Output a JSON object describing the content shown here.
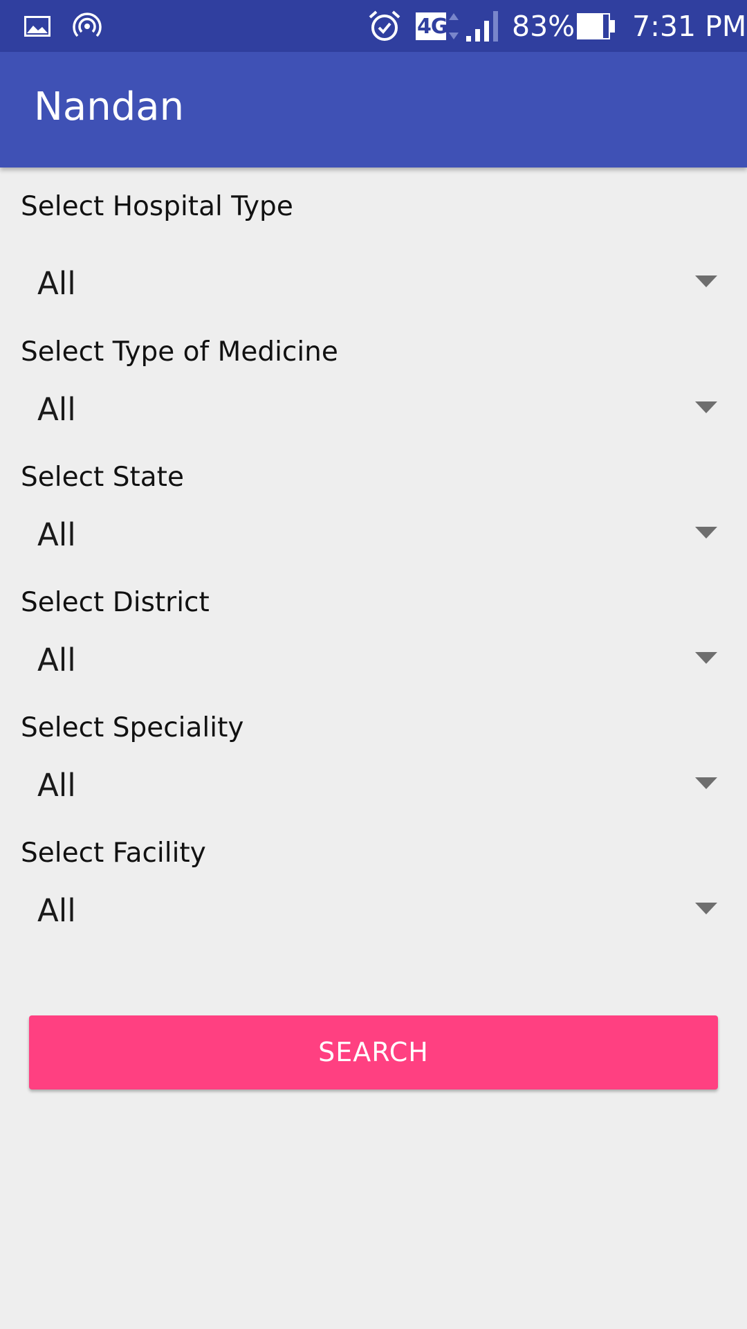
{
  "status_bar": {
    "icons_left": [
      "gallery-icon",
      "hotspot-icon"
    ],
    "icons_right": [
      "alarm-icon",
      "network-4g-icon",
      "signal-icon",
      "battery-icon"
    ],
    "network_label": "4G",
    "battery": "83%",
    "time": "7:31 PM"
  },
  "app_bar": {
    "title": "Nandan"
  },
  "form": {
    "fields": [
      {
        "label": "Select Hospital Type",
        "value": "All"
      },
      {
        "label": "Select Type of Medicine",
        "value": "All"
      },
      {
        "label": "Select State",
        "value": "All"
      },
      {
        "label": "Select District",
        "value": "All"
      },
      {
        "label": "Select Speciality",
        "value": "All"
      },
      {
        "label": "Select Facility",
        "value": "All"
      }
    ],
    "search_label": "SEARCH"
  },
  "colors": {
    "status_bar": "#303f9f",
    "app_bar": "#3f51b5",
    "accent": "#ff4081",
    "background": "#eeeeee"
  }
}
